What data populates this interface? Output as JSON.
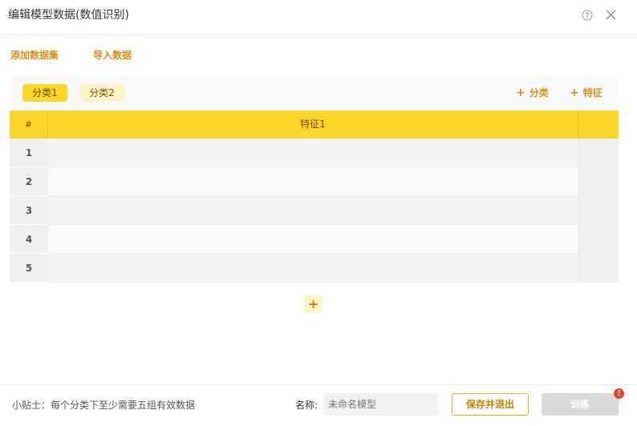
{
  "dialog": {
    "title": "编辑模型数据(数值识别)"
  },
  "actions": {
    "add_dataset": "添加数据集",
    "import_data": "导入数据"
  },
  "tabs": [
    {
      "label": "分类1",
      "active": true
    },
    {
      "label": "分类2",
      "active": false
    }
  ],
  "controls": {
    "add_category": "分类",
    "add_feature": "特征",
    "plus": "+"
  },
  "table": {
    "index_header": "#",
    "feature_header": "特征1",
    "rows": [
      {
        "index": "1",
        "value": ""
      },
      {
        "index": "2",
        "value": ""
      },
      {
        "index": "3",
        "value": ""
      },
      {
        "index": "4",
        "value": ""
      },
      {
        "index": "5",
        "value": ""
      }
    ],
    "add_row": "+"
  },
  "footer": {
    "tip": "小贴士：每个分类下至少需要五组有效数据",
    "name_label": "名称:",
    "name_placeholder": "未命名模型",
    "save_label": "保存并退出",
    "train_label": "训练",
    "alert_badge": "!"
  },
  "colors": {
    "accent": "#fdd727",
    "accent_text": "#d8901a",
    "alert": "#e8432a"
  }
}
